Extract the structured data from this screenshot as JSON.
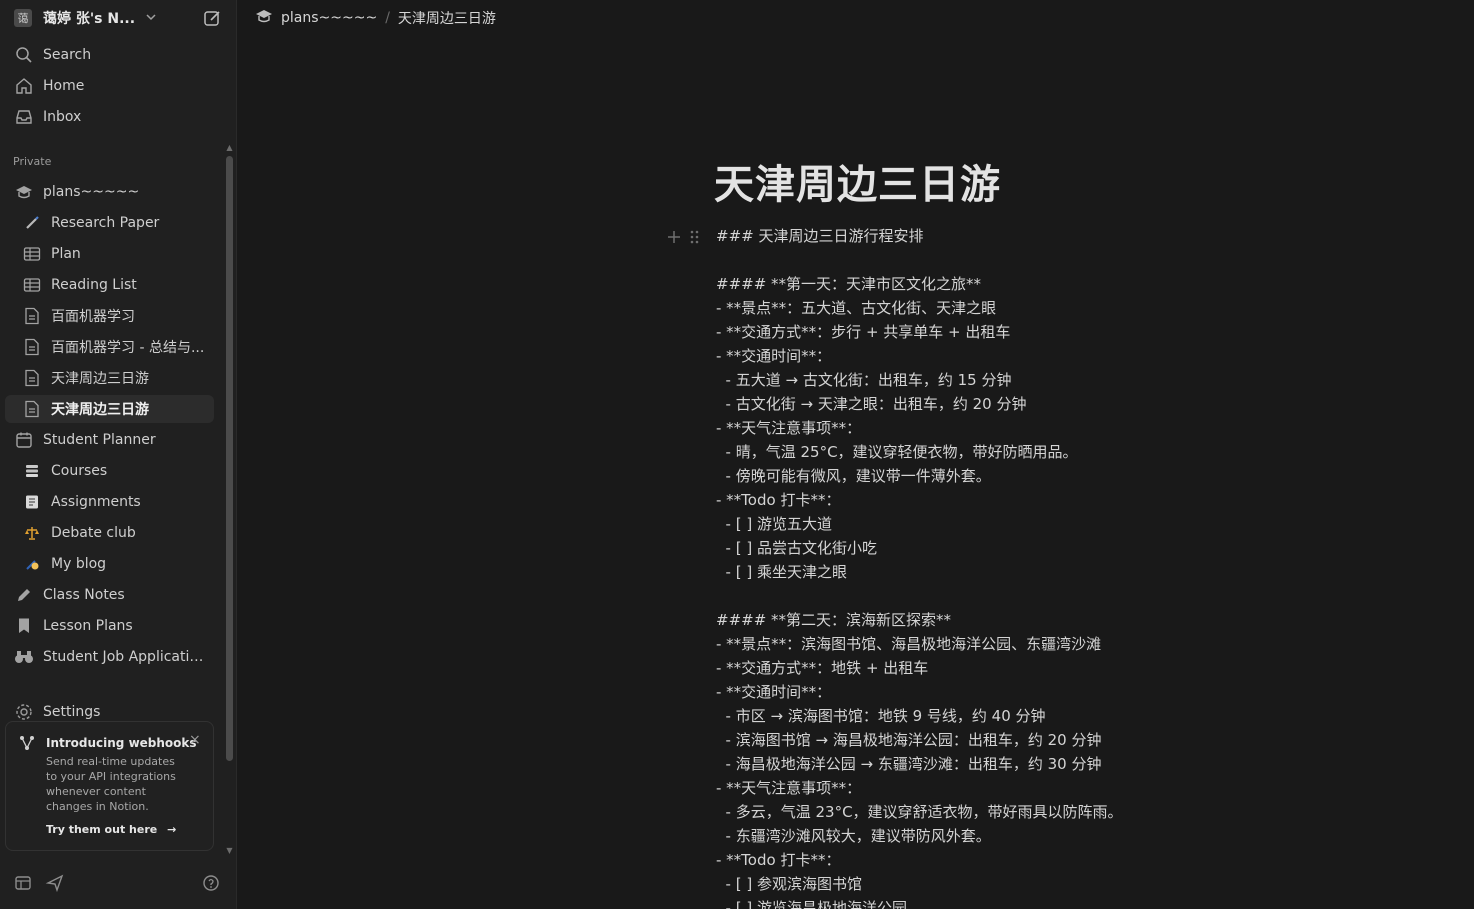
{
  "workspace": {
    "avatar_text": "蔼",
    "name": "蔼婷 张's N..."
  },
  "sidebar": {
    "top_nav": [
      {
        "label": "Search",
        "icon": "search-icon"
      },
      {
        "label": "Home",
        "icon": "home-icon"
      },
      {
        "label": "Inbox",
        "icon": "inbox-icon"
      }
    ],
    "section_label": "Private",
    "pages": [
      {
        "label": "plans~~~~~",
        "icon": "graduation-cap-icon",
        "indent": 0
      },
      {
        "label": "Research Paper",
        "icon": "pen-emoji-icon",
        "indent": 1
      },
      {
        "label": "Plan",
        "icon": "table-icon",
        "indent": 1
      },
      {
        "label": "Reading List",
        "icon": "table-icon",
        "indent": 1
      },
      {
        "label": "百面机器学习",
        "icon": "page-icon",
        "indent": 1
      },
      {
        "label": "百面机器学习 - 总结与...",
        "icon": "page-icon",
        "indent": 1
      },
      {
        "label": "天津周边三日游",
        "icon": "page-icon",
        "indent": 1
      },
      {
        "label": "天津周边三日游",
        "icon": "page-icon",
        "indent": 1,
        "active": true
      },
      {
        "label": "Student Planner",
        "icon": "calendar-icon",
        "indent": 0
      },
      {
        "label": "Courses",
        "icon": "books-emoji-icon",
        "indent": 1
      },
      {
        "label": "Assignments",
        "icon": "notebook-emoji-icon",
        "indent": 1
      },
      {
        "label": "Debate club",
        "icon": "scales-emoji-icon",
        "indent": 1
      },
      {
        "label": "My blog",
        "icon": "writing-hand-emoji-icon",
        "indent": 1
      },
      {
        "label": "Class Notes",
        "icon": "pencil-icon",
        "indent": 0
      },
      {
        "label": "Lesson Plans",
        "icon": "bookmark-icon",
        "indent": 0
      },
      {
        "label": "Student Job Applicatio...",
        "icon": "binoculars-icon",
        "indent": 0
      }
    ],
    "settings_label": "Settings",
    "promo": {
      "title": "Introducing webhooks",
      "body": "Send real-time updates to your API integrations whenever content changes in Notion.",
      "link": "Try them out here",
      "close": "×"
    }
  },
  "breadcrumb": {
    "parent": "plans~~~~~",
    "sep": "/",
    "current": "天津周边三日游"
  },
  "page": {
    "title": "天津周边三日游",
    "lines": [
      "### 天津周边三日游行程安排",
      "",
      "#### **第一天：天津市区文化之旅**",
      "- **景点**：五大道、古文化街、天津之眼",
      "- **交通方式**：步行 + 共享单车 + 出租车",
      "- **交通时间**：",
      "  - 五大道 → 古文化街：出租车，约 15 分钟",
      "  - 古文化街 → 天津之眼：出租车，约 20 分钟",
      "- **天气注意事项**：",
      "  - 晴，气温 25°C，建议穿轻便衣物，带好防晒用品。",
      "  - 傍晚可能有微风，建议带一件薄外套。",
      "- **Todo 打卡**：",
      "  - [ ] 游览五大道",
      "  - [ ] 品尝古文化街小吃",
      "  - [ ] 乘坐天津之眼",
      "",
      "#### **第二天：滨海新区探索**",
      "- **景点**：滨海图书馆、海昌极地海洋公园、东疆湾沙滩",
      "- **交通方式**：地铁 + 出租车",
      "- **交通时间**：",
      "  - 市区 → 滨海图书馆：地铁 9 号线，约 40 分钟",
      "  - 滨海图书馆 → 海昌极地海洋公园：出租车，约 20 分钟",
      "  - 海昌极地海洋公园 → 东疆湾沙滩：出租车，约 30 分钟",
      "- **天气注意事项**：",
      "  - 多云，气温 23°C，建议穿舒适衣物，带好雨具以防阵雨。",
      "  - 东疆湾沙滩风较大，建议带防风外套。",
      "- **Todo 打卡**：",
      "  - [ ] 参观滨海图书馆",
      "  - [ ] 游览海昌极地海洋公园"
    ]
  }
}
